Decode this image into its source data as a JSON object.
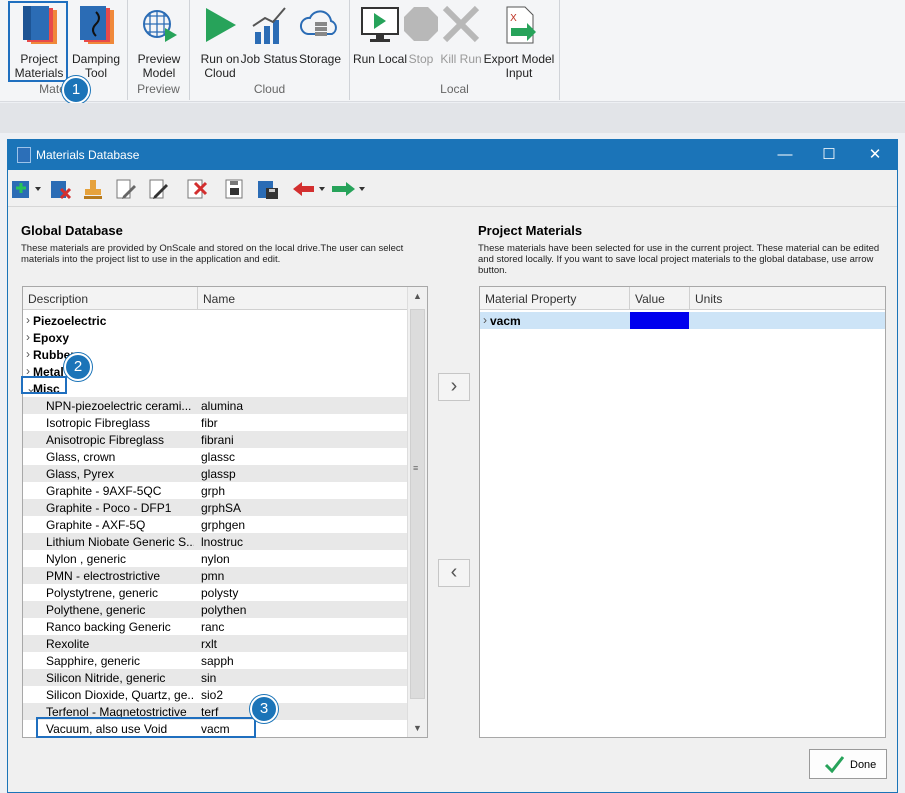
{
  "ribbon": {
    "groups": [
      {
        "title": "Materials"
      },
      {
        "title": "Preview"
      },
      {
        "title": "Cloud"
      },
      {
        "title": "Local"
      }
    ],
    "buttons": {
      "project_materials": "Project Materials",
      "damping_tool": "Damping Tool",
      "preview_model": "Preview Model",
      "run_on_cloud": "Run on Cloud",
      "job_status": "Job Status",
      "storage": "Storage",
      "run_local": "Run Local",
      "stop": "Stop",
      "kill_run": "Kill Run",
      "export_model_input": "Export Model Input"
    }
  },
  "badges": [
    "1",
    "2",
    "3"
  ],
  "dialog": {
    "title": "Materials Database",
    "global": {
      "heading": "Global Database",
      "note": "These materials are provided by OnScale and stored on the local drive.The user can select materials into the project list to use in the application and edit.",
      "columns": {
        "description": "Description",
        "name": "Name"
      },
      "groups": [
        "Piezoelectric",
        "Epoxy",
        "Rubber",
        "Metal",
        "Misc"
      ],
      "items": [
        {
          "desc": "NPN-piezoelectric cerami...",
          "name": "alumina"
        },
        {
          "desc": "Isotropic Fibreglass",
          "name": "fibr"
        },
        {
          "desc": "Anisotropic Fibreglass",
          "name": "fibrani"
        },
        {
          "desc": "Glass, crown",
          "name": "glassc"
        },
        {
          "desc": "Glass, Pyrex",
          "name": "glassp"
        },
        {
          "desc": "Graphite - 9AXF-5QC",
          "name": "grph"
        },
        {
          "desc": "Graphite - Poco - DFP1",
          "name": "grphSA"
        },
        {
          "desc": "Graphite - AXF-5Q",
          "name": "grphgen"
        },
        {
          "desc": "Lithium Niobate Generic S...",
          "name": "lnostruc"
        },
        {
          "desc": "Nylon , generic",
          "name": "nylon"
        },
        {
          "desc": "PMN - electrostrictive",
          "name": "pmn"
        },
        {
          "desc": "Polystytrene, generic",
          "name": "polysty"
        },
        {
          "desc": "Polythene, generic",
          "name": "polythen"
        },
        {
          "desc": "Ranco backing Generic",
          "name": "ranc"
        },
        {
          "desc": "Rexolite",
          "name": "rxlt"
        },
        {
          "desc": "Sapphire, generic",
          "name": "sapph"
        },
        {
          "desc": "Silicon Nitride, generic",
          "name": "sin"
        },
        {
          "desc": "Silicon Dioxide, Quartz, ge...",
          "name": "sio2"
        },
        {
          "desc": "Terfenol - Magnetostrictive",
          "name": "terf"
        },
        {
          "desc": "Vacuum, also use Void",
          "name": "vacm"
        }
      ]
    },
    "project": {
      "heading": "Project Materials",
      "note": "These materials have been selected for use in the current project. These material can be edited and stored locally. If you want to save local project materials to the global database, use arrow button.",
      "columns": {
        "property": "Material Property",
        "value": "Value",
        "units": "Units"
      },
      "rows": [
        {
          "name": "vacm",
          "color": "#0000ee"
        }
      ]
    },
    "done_label": "Done"
  }
}
